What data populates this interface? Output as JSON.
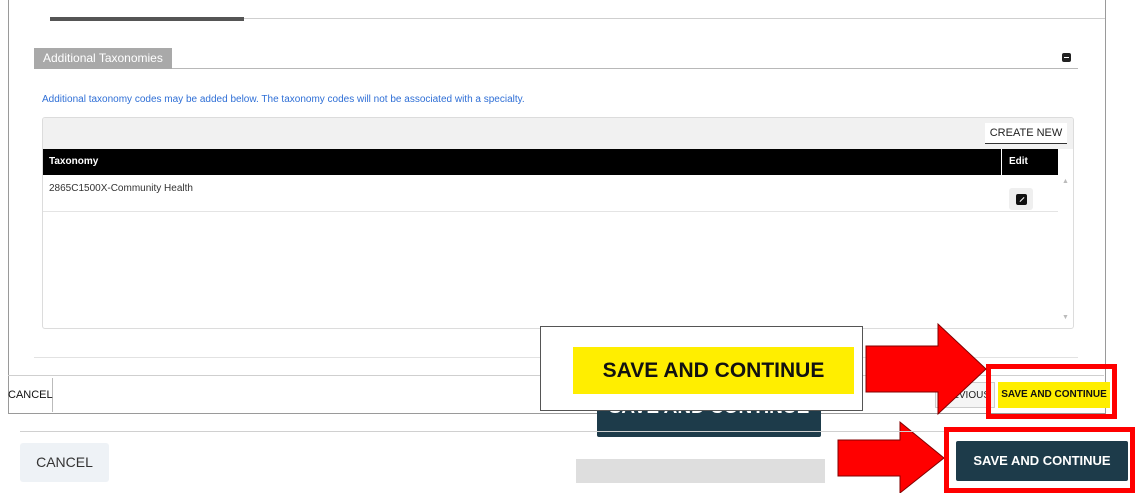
{
  "section": {
    "title": "Additional Taxonomies",
    "info": "Additional taxonomy codes may be added below. The taxonomy codes will not be associated with a specialty."
  },
  "grid": {
    "create_new_label": "CREATE NEW",
    "columns": [
      "Taxonomy",
      "Edit"
    ],
    "rows": [
      {
        "taxonomy": "2865C1500X-Community Health"
      }
    ]
  },
  "footer_small": {
    "cancel_label": "CANCEL",
    "previous_label": "EVIOUS",
    "save_label": "SAVE AND CONTINUE"
  },
  "zoom_callout": {
    "save_label": "SAVE AND CONTINUE",
    "behind_label": "SAVE AND CONTINUE"
  },
  "footer_large": {
    "cancel_label": "CANCEL",
    "save_label": "SAVE AND CONTINUE"
  },
  "icons": [
    "collapse-icon",
    "edit-icon",
    "arrow-icon"
  ],
  "colors": {
    "highlight_yellow": "#ffee00",
    "annotation_red": "#ff0000",
    "primary_button": "#1d3b4a",
    "info_text": "#2f6fd6"
  }
}
